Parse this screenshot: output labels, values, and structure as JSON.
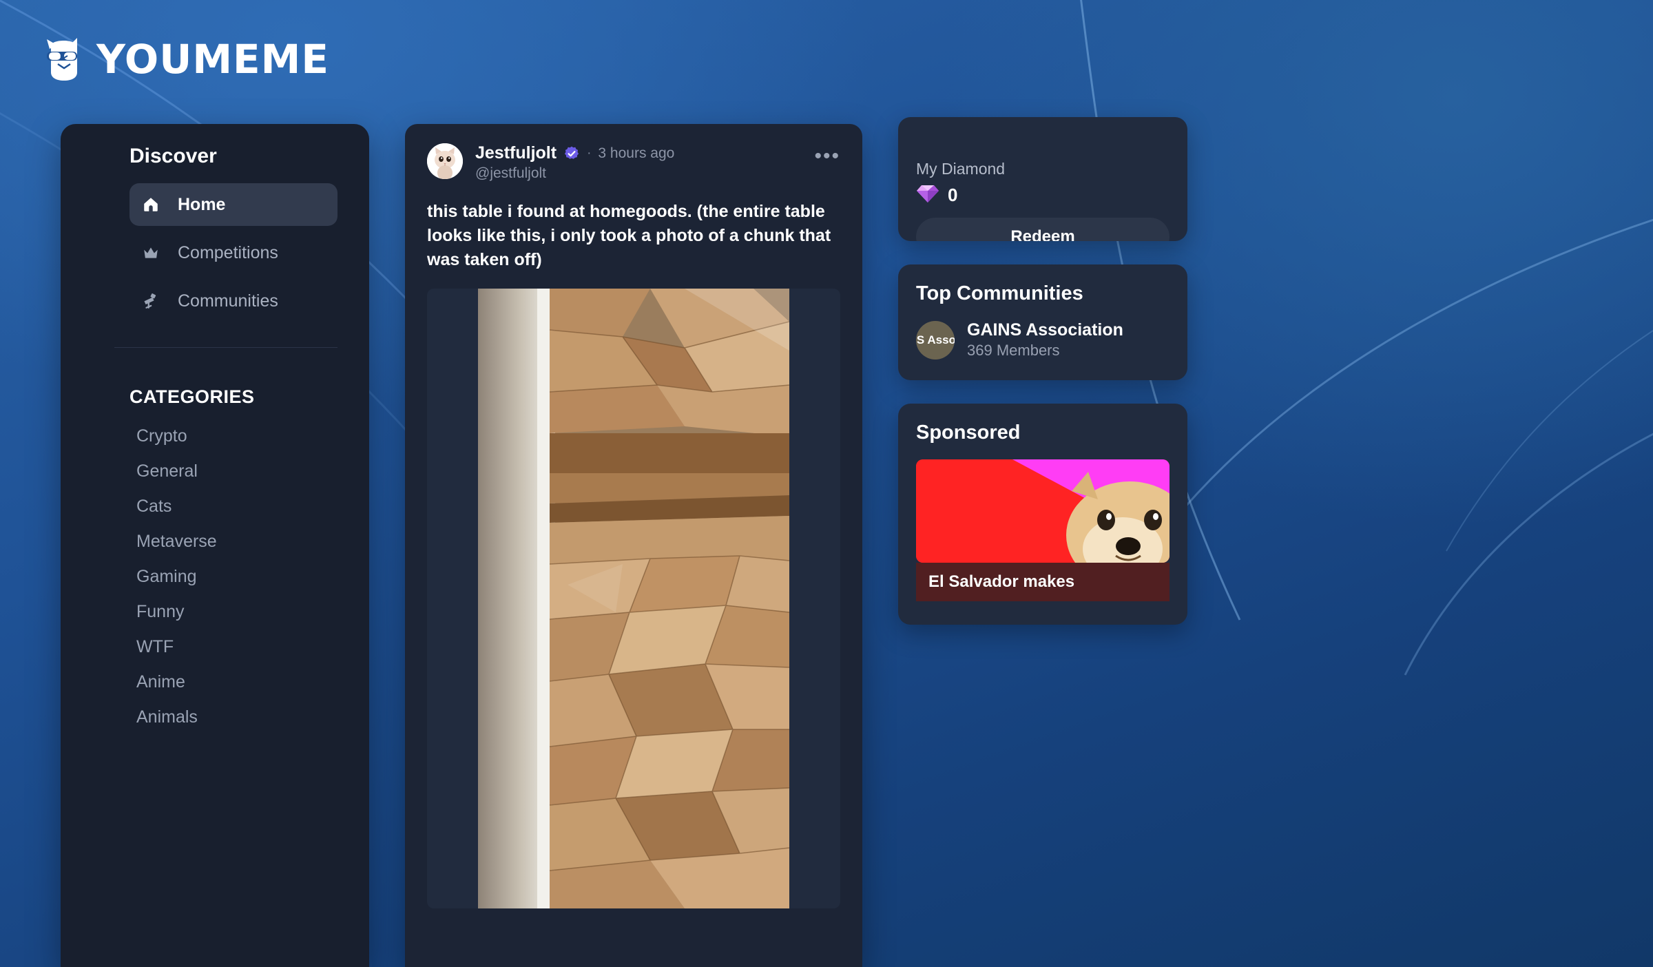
{
  "brand": {
    "name": "YOUMEME",
    "logo_icon": "youmeme-dog-logo"
  },
  "sidebar": {
    "discover_title": "Discover",
    "nav": [
      {
        "label": "Home",
        "icon": "home-icon",
        "active": true
      },
      {
        "label": "Competitions",
        "icon": "crown-icon",
        "active": false
      },
      {
        "label": "Communities",
        "icon": "telescope-icon",
        "active": false
      }
    ],
    "categories_title": "CATEGORIES",
    "categories": [
      "Crypto",
      "General",
      "Cats",
      "Metaverse",
      "Gaming",
      "Funny",
      "WTF",
      "Anime",
      "Animals"
    ]
  },
  "post": {
    "author_name": "Jestfuljolt",
    "author_handle": "@jestfuljolt",
    "verified": true,
    "verified_icon": "verified-badge-icon",
    "separator": "·",
    "timestamp": "3 hours ago",
    "more_icon": "more-options-icon",
    "avatar_icon": "cat-avatar",
    "body": "this table i found at homegoods. (the entire table looks like this, i only took a photo of a chunk that was taken off)",
    "media_alt": "wooden mosaic table close-up"
  },
  "rail": {
    "diamond": {
      "label": "My Diamond",
      "icon": "diamond-icon",
      "count": "0",
      "button_label": "Redeem"
    },
    "communities": {
      "title": "Top Communities",
      "items": [
        {
          "avatar_text": "NS Assoc",
          "name": "GAINS Association",
          "members": "369 Members"
        }
      ]
    },
    "sponsored": {
      "title": "Sponsored",
      "caption": "El Salvador makes",
      "media_alt": "doge meme magenta red banner"
    }
  },
  "colors": {
    "background_blue": "#1f5296",
    "panel_dark": "#181f2e",
    "card_dark": "#212b3e",
    "accent_purple": "#6c5ce7",
    "text_primary": "#ffffff",
    "text_muted": "#9aa3b4",
    "sponsor_magenta": "#ff3df5",
    "sponsor_red": "#ff2323"
  }
}
